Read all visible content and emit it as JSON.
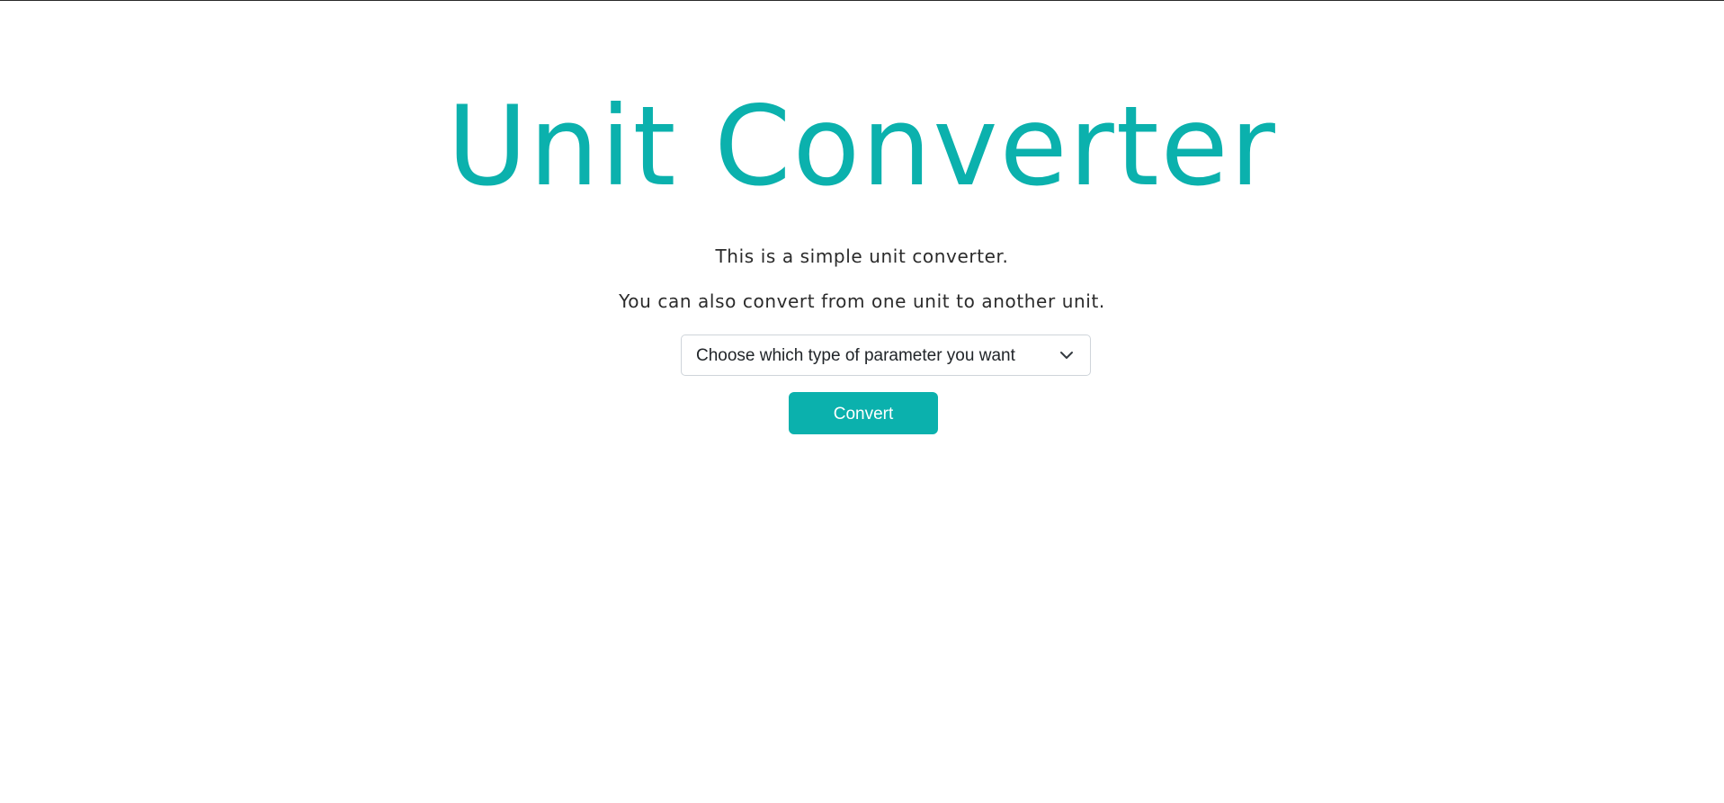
{
  "header": {
    "title": "Unit Converter"
  },
  "main": {
    "intro_line_1": "This is a simple unit converter.",
    "intro_line_2": "You can also convert from one unit to another unit.",
    "parameter_select": {
      "selected_value": "Choose which type of parameter you want",
      "icon": "chevron-down-icon"
    },
    "convert_button_label": "Convert"
  },
  "colors": {
    "accent": "#0bb1ad",
    "text": "#2b2b2b",
    "select_border": "#cfd4da",
    "background": "#ffffff"
  }
}
